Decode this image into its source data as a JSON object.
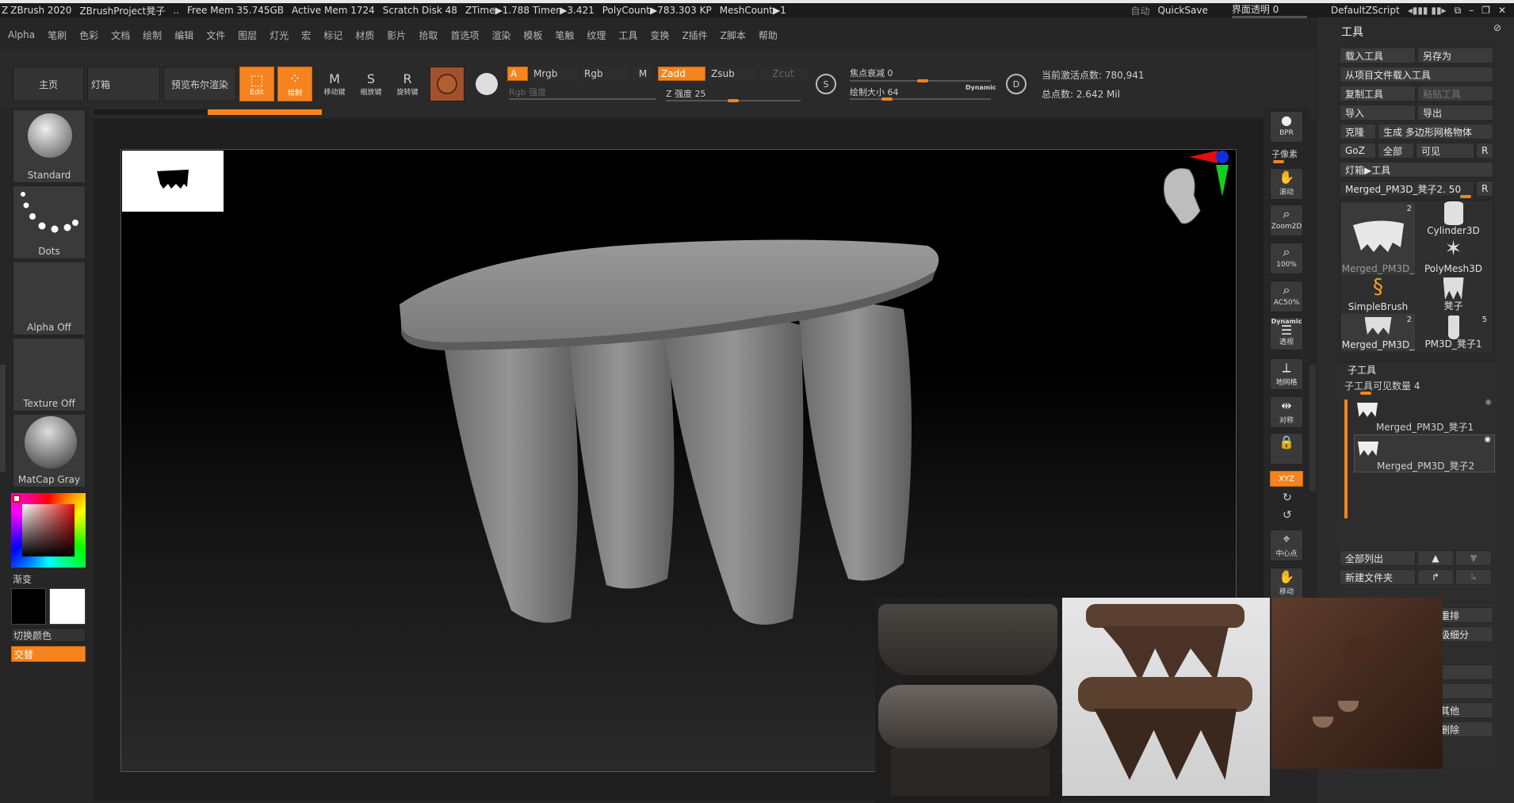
{
  "titlebar": {
    "app": "ZBrush 2020",
    "project": "ZBrushProject凳子",
    "dots": "..",
    "free_mem": "Free Mem 35.745GB",
    "active_mem": "Active Mem 1724",
    "scratch": "Scratch Disk 48",
    "ztime": "ZTime▶1.788 Timer▶3.421",
    "polycount": "PolyCount▶783.303 KP",
    "meshcount": "MeshCount▶1",
    "auto": "自动",
    "quicksave": "QuickSave",
    "transparency": "界面透明 0",
    "script": "DefaultZScript"
  },
  "menu": [
    "Alpha",
    "笔刷",
    "色彩",
    "文档",
    "绘制",
    "编辑",
    "文件",
    "图层",
    "灯光",
    "宏",
    "标记",
    "材质",
    "影片",
    "拾取",
    "首选项",
    "渲染",
    "模板",
    "笔触",
    "纹理",
    "工具",
    "变换",
    "Z插件",
    "Z脚本",
    "帮助"
  ],
  "toolbar": {
    "home": "主页",
    "lightbox": "灯箱",
    "bpr": "预览布尔渲染",
    "edit": "Edit",
    "draw": "绘制",
    "move": "移动键",
    "scale": "缩放键",
    "rotate": "旋转键",
    "a": "A",
    "mrgb": "Mrgb",
    "rgb": "Rgb",
    "m": "M",
    "zadd": "Zadd",
    "zsub": "Zsub",
    "zcut": "Zcut",
    "rgb_intensity": "Rgb 强度",
    "z_intensity": "Z 强度 25",
    "focal": "焦点衰减 0",
    "draw_size": "绘制大小 64",
    "dynamic": "Dynamic",
    "active_points": "当前激活点数: 780,941",
    "total_points": "总点数: 2.642 Mil",
    "s_label": "S",
    "d_label": "D"
  },
  "left": {
    "brush": "Standard",
    "stroke": "Dots",
    "alpha": "Alpha Off",
    "texture": "Texture Off",
    "material": "MatCap Gray",
    "gradient": "渐变",
    "switch_color": "切换颜色",
    "alternate": "交替"
  },
  "righttools": [
    {
      "icon": "bpr",
      "label": "BPR"
    },
    {
      "icon": "subpixel",
      "label": "子像素"
    },
    {
      "icon": "scroll",
      "label": "滚动"
    },
    {
      "icon": "zoom2d",
      "label": "Zoom2D"
    },
    {
      "icon": "100",
      "label": "100%"
    },
    {
      "icon": "ac50",
      "label": "AC50%"
    },
    {
      "icon": "perspective",
      "label": "透视"
    },
    {
      "icon": "floor",
      "label": "地网格"
    },
    {
      "icon": "symmetry",
      "label": "对称"
    },
    {
      "icon": "lock",
      "label": ""
    },
    {
      "icon": "xyz",
      "label": "XYZ"
    },
    {
      "icon": "center",
      "label": "中心点"
    },
    {
      "icon": "move",
      "label": "移动"
    }
  ],
  "dynamic_label": "Dynamic",
  "toolpanel": {
    "title": "工具",
    "load": "载入工具",
    "save_as": "另存为",
    "load_from_project": "从项目文件载入工具",
    "copy": "复制工具",
    "paste": "粘贴工具",
    "import": "导入",
    "export": "导出",
    "clone": "克隆",
    "make_polymesh": "生成 多边形网格物体",
    "goz": "GoZ",
    "all": "全部",
    "visible": "可见",
    "r": "R",
    "lightbox_tools": "灯箱▶工具",
    "current_tool": "Merged_PM3D_凳子2. 50",
    "tools": [
      {
        "name": "Merged_PM3D_",
        "num": "2"
      },
      {
        "name": "Cylinder3D",
        "num": ""
      },
      {
        "name": "",
        "num": ""
      },
      {
        "name": "PolyMesh3D",
        "num": ""
      },
      {
        "name": "SimpleBrush",
        "num": ""
      },
      {
        "name": "凳子",
        "num": ""
      },
      {
        "name": "Merged_PM3D_",
        "num": "2"
      },
      {
        "name": "PM3D_凳子1",
        "num": "5"
      }
    ],
    "subtool_title": "子工具",
    "subtool_visible": "子工具可见数量 4",
    "subtools": [
      "Merged_PM3D_凳子1",
      "Merged_PM3D_凳子2"
    ],
    "list_all": "全部列出",
    "new_folder": "新建文件夹",
    "rename": "重排",
    "subdivide": "级细分",
    "other": "其他",
    "delete": "删除"
  }
}
